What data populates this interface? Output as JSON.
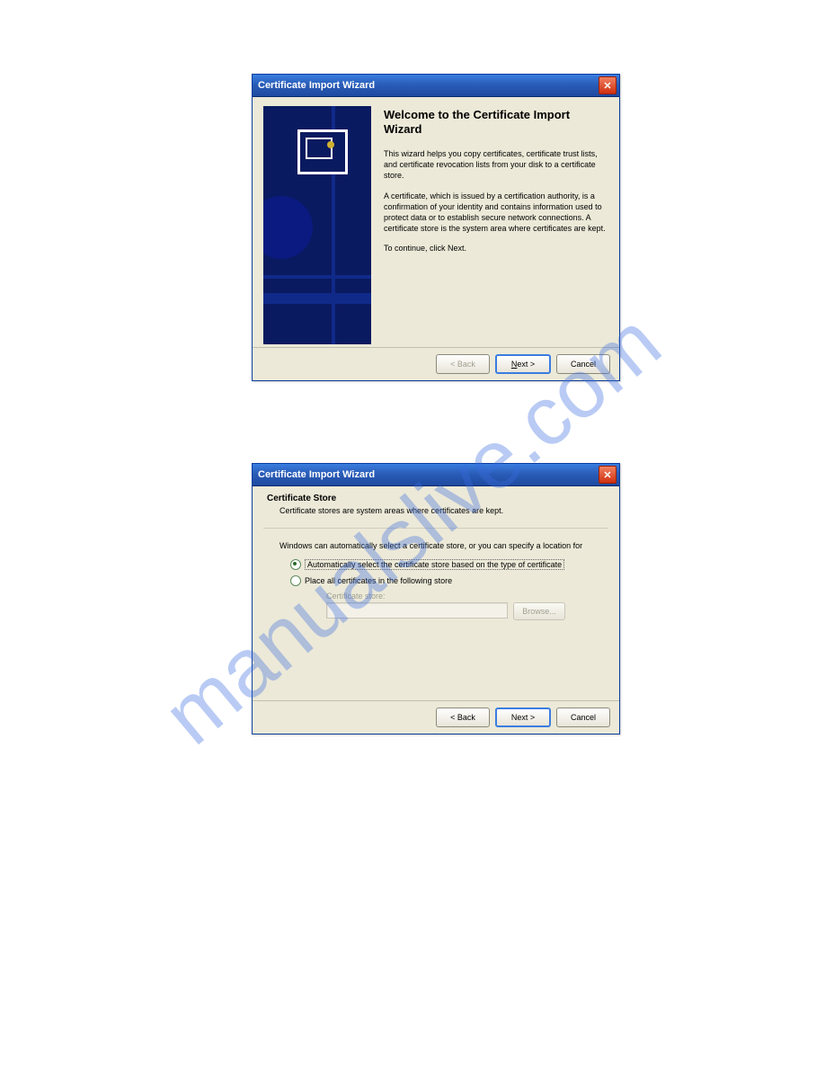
{
  "watermark": "manualslive.com",
  "dialog1": {
    "title": "Certificate Import Wizard",
    "heading": "Welcome to the Certificate Import Wizard",
    "para1": "This wizard helps you copy certificates, certificate trust lists, and certificate revocation lists from your disk to a certificate store.",
    "para2": "A certificate, which is issued by a certification authority, is a confirmation of your identity and contains information used to protect data or to establish secure network connections. A certificate store is the system area where certificates are kept.",
    "para3": "To continue, click Next.",
    "back": "< Back",
    "next": "Next >",
    "cancel": "Cancel"
  },
  "dialog2": {
    "title": "Certificate Import Wizard",
    "subhead": "Certificate Store",
    "subdesc": "Certificate stores are system areas where certificates are kept.",
    "instr": "Windows can automatically select a certificate store, or you can specify a location for",
    "opt1": "Automatically select the certificate store based on the type of certificate",
    "opt2": "Place all certificates in the following store",
    "storelabel": "Certificate store:",
    "browse": "Browse...",
    "back": "< Back",
    "next": "Next >",
    "cancel": "Cancel"
  }
}
